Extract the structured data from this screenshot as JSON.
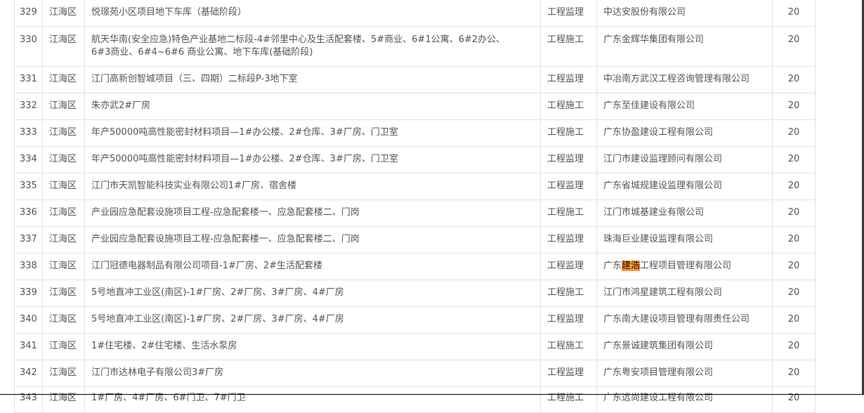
{
  "table": {
    "rows": [
      {
        "no": "329",
        "district": "江海区",
        "project": "悦璟苑小区项目地下车库（基础阶段）",
        "type": "工程监理",
        "company": "中达安股份有限公司",
        "score": "20"
      },
      {
        "no": "330",
        "district": "江海区",
        "project": "航天华南(安全应急)特色产业基地二标段-4#邻里中心及生活配套楼、5#商业、6#1公寓、6#2办公、6#3商业、6#4~6#6 商业公寓、地下车库(基础阶段)",
        "type": "工程施工",
        "company": "广东金辉华集团有限公司",
        "score": "20"
      },
      {
        "no": "331",
        "district": "江海区",
        "project": "江门高新创智城项目（三、四期）二标段P-3地下室",
        "type": "工程监理",
        "company": "中冶南方武汉工程咨询管理有限公司",
        "score": "20"
      },
      {
        "no": "332",
        "district": "江海区",
        "project": "朱亦武2#厂房",
        "type": "工程施工",
        "company": "广东至佳建设有限公司",
        "score": "20"
      },
      {
        "no": "333",
        "district": "江海区",
        "project": "年产50000吨高性能密封材料项目—1#办公楼、2#仓库、3#厂房、门卫室",
        "type": "工程施工",
        "company": "广东协盈建设工程有限公司",
        "score": "20"
      },
      {
        "no": "334",
        "district": "江海区",
        "project": "年产50000吨高性能密封材料项目—1#办公楼、2#仓库、3#厂房、门卫室",
        "type": "工程监理",
        "company": "江门市建设监理顾问有限公司",
        "score": "20"
      },
      {
        "no": "335",
        "district": "江海区",
        "project": "江门市天凯智能科技实业有限公司1#厂房、宿舍楼",
        "type": "工程监理",
        "company": "广东省城规建设监理有限公司",
        "score": "20"
      },
      {
        "no": "336",
        "district": "江海区",
        "project": "产业园应急配套设施项目工程-应急配套楼一、应急配套楼二、门岗",
        "type": "工程施工",
        "company": "江门市城基建业有限公司",
        "score": "20"
      },
      {
        "no": "337",
        "district": "江海区",
        "project": "产业园应急配套设施项目工程-应急配套楼一、应急配套楼二、门岗",
        "type": "工程监理",
        "company": "珠海巨业建设监理有限公司",
        "score": "20"
      },
      {
        "no": "338",
        "district": "江海区",
        "project": "江门冠德电器制品有限公司项目-1#厂房、2#生活配套楼",
        "type": "工程监理",
        "company_pre": "广东",
        "company_hl": "建浩",
        "company_post": "工程项目管理有限公司",
        "score": "20"
      },
      {
        "no": "339",
        "district": "江海区",
        "project": "5号地直冲工业区(南区)-1#厂房、2#厂房、3#厂房、4#厂房",
        "type": "工程施工",
        "company": "江门市鸿星建筑工程有限公司",
        "score": "20"
      },
      {
        "no": "340",
        "district": "江海区",
        "project": "5号地直冲工业区(南区)-1#厂房、2#厂房、3#厂房、4#厂房",
        "type": "工程监理",
        "company": "广东南大建设项目管理有限责任公司",
        "score": "20"
      },
      {
        "no": "341",
        "district": "江海区",
        "project": "1#住宅楼、2#住宅楼、生活水泵房",
        "type": "工程施工",
        "company": "广东景诚建筑集团有限公司",
        "score": "20"
      },
      {
        "no": "342",
        "district": "江海区",
        "project": "江门市达林电子有限公司3#厂房",
        "type": "工程监理",
        "company": "广东粤安项目管理有限公司",
        "score": "20"
      },
      {
        "no": "343",
        "district": "江海区",
        "project": "1#厂房、4#厂房、6#门卫、7#门卫",
        "type": "工程施工",
        "company": "广东远尚建设工程有限公司",
        "score": "20"
      }
    ]
  }
}
